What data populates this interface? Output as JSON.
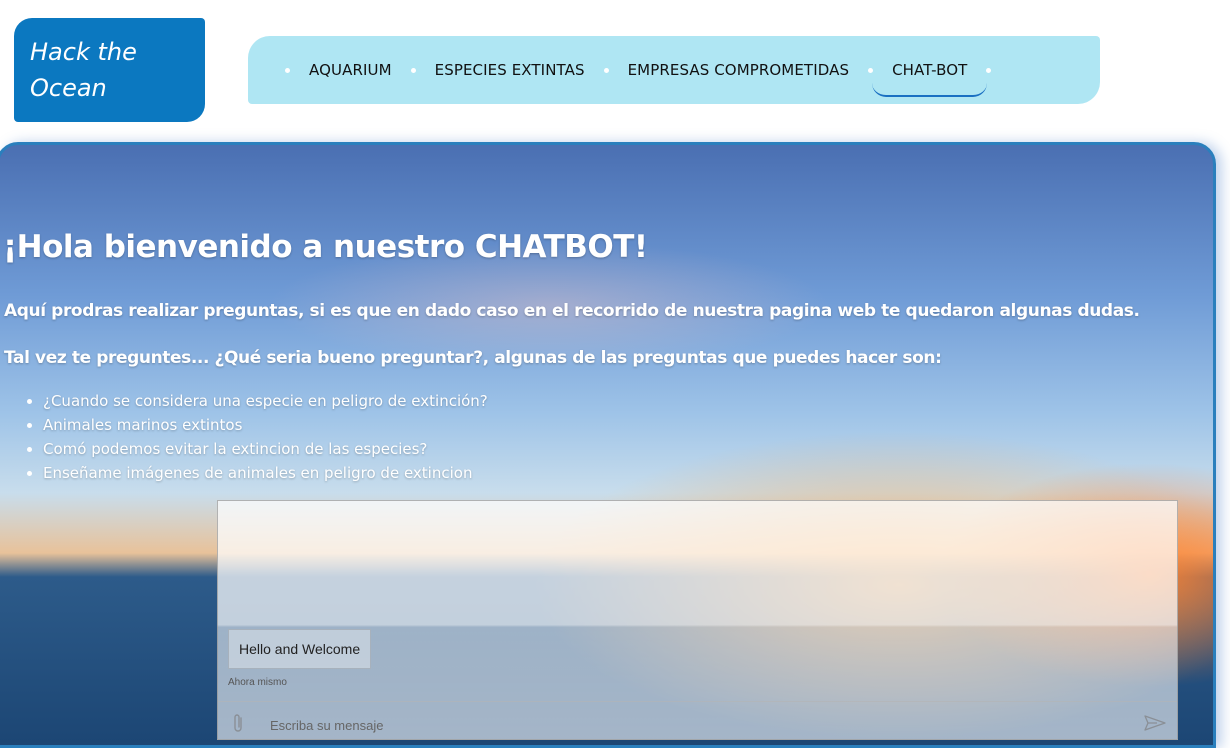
{
  "logo": {
    "line1": "Hack the",
    "line2": "Ocean"
  },
  "nav": {
    "items": [
      {
        "label": "AQUARIUM"
      },
      {
        "label": "ESPECIES EXTINTAS"
      },
      {
        "label": "EMPRESAS COMPROMETIDAS"
      },
      {
        "label": "CHAT-BOT",
        "active": true
      }
    ]
  },
  "hero": {
    "title": "¡Hola bienvenido a nuestro CHATBOT!",
    "intro": "Aquí prodras realizar preguntas, si es que en dado caso en el recorrido de nuestra pagina web te quedaron algunas dudas.",
    "hint": "Tal vez te preguntes... ¿Qué seria bueno preguntar?, algunas de las preguntas que puedes hacer son:",
    "questions": [
      "¿Cuando se considera una especie en peligro de extinción?",
      "Animales marinos extintos",
      "Comó podemos evitar la extincion de las especies?",
      "Enseñame imágenes de animales en peligro de extincion"
    ]
  },
  "chat": {
    "message": "Hello and Welcome",
    "timestamp": "Ahora mismo",
    "input_placeholder": "Escriba su mensaje",
    "input_value": ""
  },
  "colors": {
    "logo_bg": "#0b78c0",
    "nav_bg": "#afe6f3",
    "active_underline": "#1a70c2",
    "frame_border": "#2a7fbd"
  }
}
